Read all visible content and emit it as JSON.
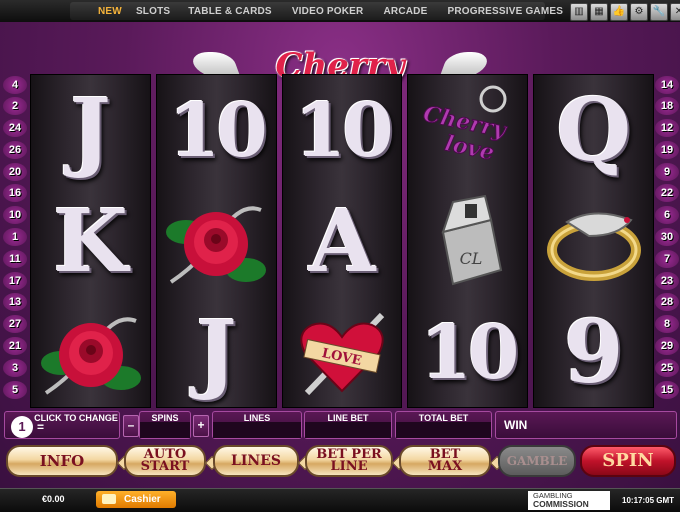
{
  "nav": {
    "items": [
      "NEW",
      "SLOTS",
      "TABLE & CARDS",
      "VIDEO POKER",
      "ARCADE",
      "PROGRESSIVE GAMES"
    ],
    "active_color": "#f5b33a"
  },
  "toolbar_icons": [
    "layout-1-icon",
    "layout-4-icon",
    "thumbs-up-icon",
    "settings-icon",
    "tools-icon",
    "close-icon"
  ],
  "game": {
    "title": "Cherry Love",
    "lines_left": [
      "4",
      "2",
      "24",
      "26",
      "20",
      "16",
      "10",
      "1",
      "11",
      "17",
      "13",
      "27",
      "21",
      "3",
      "5"
    ],
    "lines_right": [
      "14",
      "18",
      "12",
      "19",
      "9",
      "22",
      "6",
      "30",
      "7",
      "23",
      "28",
      "8",
      "29",
      "25",
      "15"
    ],
    "reels": [
      [
        "J",
        "K",
        "rose-symbol"
      ],
      [
        "10",
        "rose-symbol",
        "J"
      ],
      [
        "10",
        "A",
        "love-heart-symbol"
      ],
      [
        "cherry-love-logo-symbol",
        "lighter-symbol",
        "10"
      ],
      [
        "Q",
        "ring-symbol",
        "9"
      ]
    ],
    "symbol_labels": {
      "cherry_logo_line1": "Cherry",
      "cherry_logo_line2": "love",
      "heart_text": "LOVE",
      "lighter_monogram": "CL"
    }
  },
  "controls": {
    "coin_value": "1",
    "coin_equals": "=",
    "click_to_change": "CLICK TO CHANGE",
    "spins_label": "SPINS",
    "minus": "–",
    "plus": "+",
    "lines_label": "LINES",
    "line_bet_label": "LINE BET",
    "total_bet_label": "TOTAL BET",
    "win_label": "WIN"
  },
  "buttons": {
    "info": "INFO",
    "auto_start_1": "AUTO",
    "auto_start_2": "START",
    "lines": "LINES",
    "bet_per_line_1": "BET PER",
    "bet_per_line_2": "LINE",
    "bet_max_1": "BET",
    "bet_max_2": "MAX",
    "gamble": "GAMBLE",
    "spin": "SPIN"
  },
  "footer": {
    "balance": "€0.00",
    "cashier": "Cashier",
    "gc_line1": "GAMBLING",
    "gc_line2": "COMMISSION",
    "clock": "10:17:05 GMT"
  }
}
